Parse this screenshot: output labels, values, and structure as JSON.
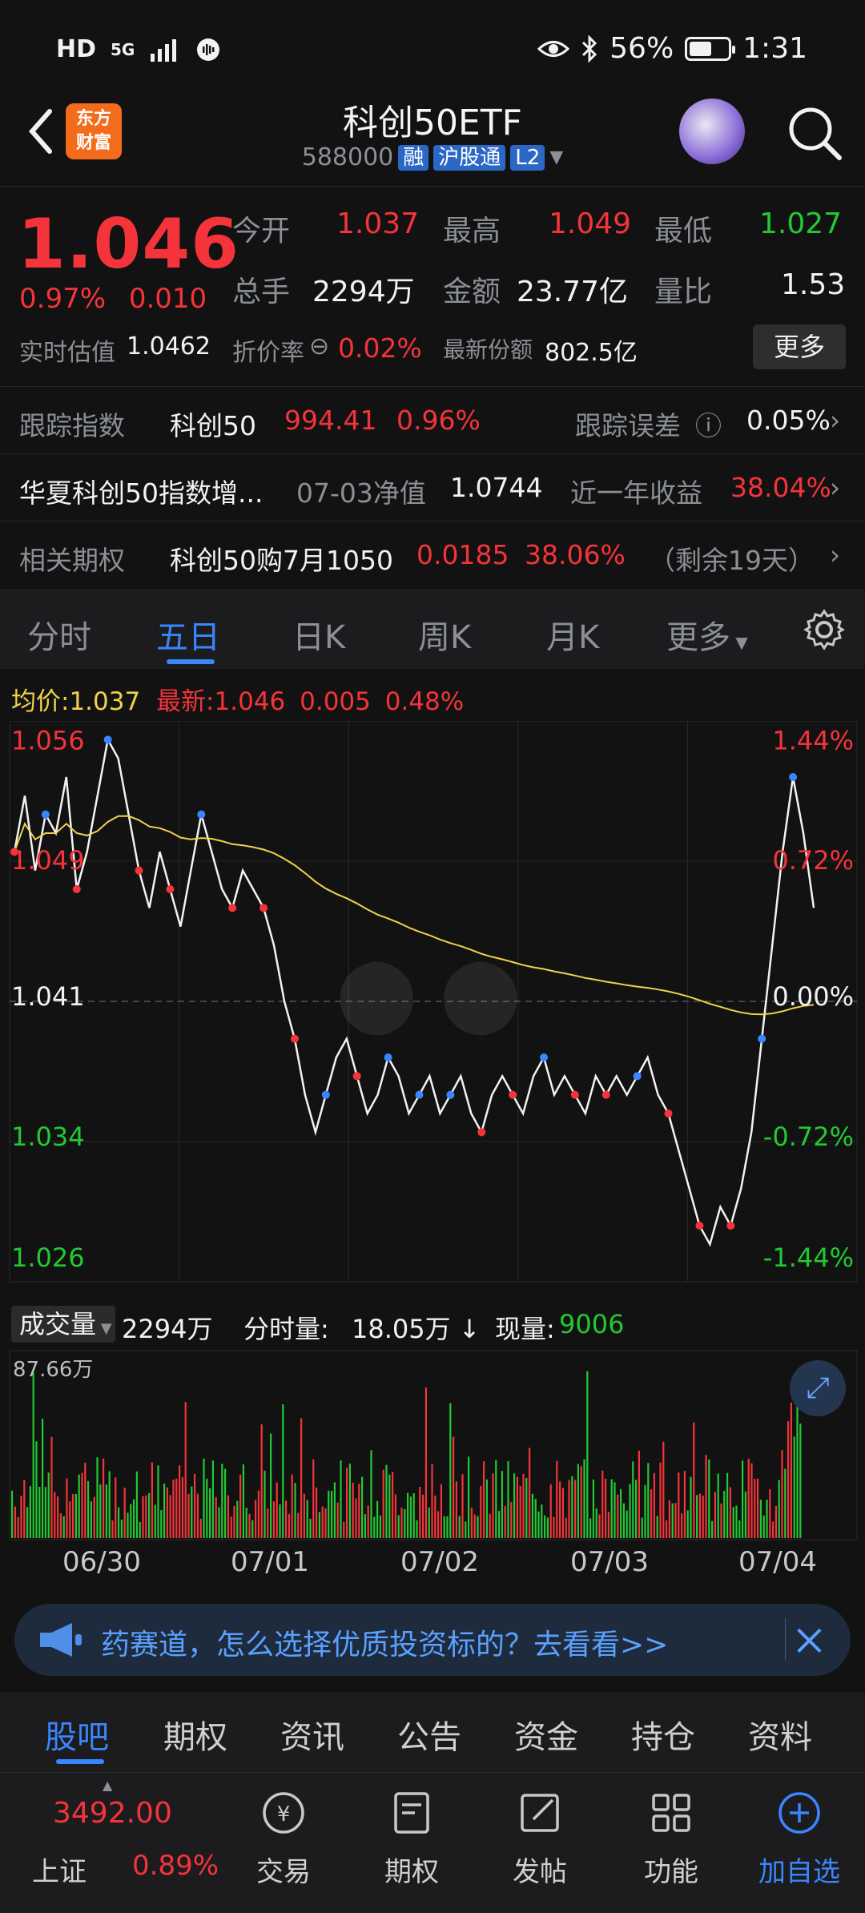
{
  "status_bar": {
    "left": [
      "HD",
      "5G",
      "signal-icon",
      "audio-icon"
    ],
    "battery_percent": "56%",
    "battery_level": 0.56,
    "time": "1:31"
  },
  "header": {
    "logo_text_line1": "东方",
    "logo_text_line2": "财富",
    "title": "科创50ETF",
    "code": "588000",
    "tags": [
      "融",
      "沪股通",
      "L2"
    ]
  },
  "quote": {
    "price": "1.046",
    "change_pct": "0.97%",
    "change_abs": "0.010",
    "open_label": "今开",
    "open": "1.037",
    "high_label": "最高",
    "high": "1.049",
    "low_label": "最低",
    "low": "1.027",
    "volume_label": "总手",
    "volume": "2294万",
    "amount_label": "金额",
    "amount": "23.77亿",
    "ratio_label": "量比",
    "ratio": "1.53",
    "iopv_label": "实时估值",
    "iopv": "1.0462",
    "premium_label": "折价率",
    "premium": "0.02%",
    "shares_label": "最新份额",
    "shares": "802.5亿",
    "more_label": "更多"
  },
  "info_rows": {
    "track_label": "跟踪指数",
    "track_name": "科创50",
    "track_value": "994.41",
    "track_pct": "0.96%",
    "error_label": "跟踪误差",
    "error_value": "0.05%",
    "fund_name": "华夏科创50指数增...",
    "nav_label": "07-03净值",
    "nav_value": "1.0744",
    "yield_label": "近一年收益",
    "yield_value": "38.04%",
    "option_label": "相关期权",
    "option_name": "科创50购7月1050",
    "option_price": "0.0185",
    "option_pct": "38.06%",
    "option_days": "（剩余19天）"
  },
  "chart_tabs": [
    "分时",
    "五日",
    "日K",
    "周K",
    "月K",
    "更多"
  ],
  "chart_header": {
    "avg_label": "均价:",
    "avg_value": "1.037",
    "last_label": "最新:",
    "last_value": "1.046",
    "last_chg": "0.005",
    "last_pct": "0.48%"
  },
  "chart_data": {
    "type": "line",
    "y_labels_left": [
      "1.056",
      "1.049",
      "1.041",
      "1.034",
      "1.026"
    ],
    "y_labels_right": [
      "1.44%",
      "0.72%",
      "0.00%",
      "-0.72%",
      "-1.44%"
    ],
    "ylim": [
      1.026,
      1.056
    ],
    "x_labels": [
      "06/30",
      "07/01",
      "07/02",
      "07/03",
      "07/04"
    ],
    "series": [
      {
        "values": [
          1.049,
          1.052,
          1.048,
          1.051,
          1.05,
          1.053,
          1.047,
          1.049,
          1.052,
          1.055,
          1.054,
          1.051,
          1.048,
          1.046,
          1.049,
          1.047,
          1.045,
          1.048,
          1.051,
          1.049,
          1.047,
          1.046,
          1.048,
          1.047,
          1.046,
          1.044,
          1.041,
          1.039,
          1.036,
          1.034,
          1.036,
          1.038,
          1.039,
          1.037,
          1.035,
          1.036,
          1.038,
          1.037,
          1.035,
          1.036,
          1.037,
          1.035,
          1.036,
          1.037,
          1.035,
          1.034,
          1.036,
          1.037,
          1.036,
          1.035,
          1.037,
          1.038,
          1.036,
          1.037,
          1.036,
          1.035,
          1.037,
          1.036,
          1.037,
          1.036,
          1.037,
          1.038,
          1.036,
          1.035,
          1.033,
          1.031,
          1.029,
          1.028,
          1.03,
          1.029,
          1.031,
          1.034,
          1.039,
          1.044,
          1.049,
          1.053,
          1.05,
          1.046
        ]
      }
    ],
    "volume": {
      "total_label": "成交量",
      "total": "2294万",
      "tick_label": "分时量:",
      "tick_value": "18.05万 ↓",
      "now_label": "现量:",
      "now_value": "9006",
      "max_label": "87.66万"
    }
  },
  "promo": {
    "text": "药赛道，怎么选择优质投资标的？去看看>>"
  },
  "section_tabs": [
    "股吧",
    "期权",
    "资讯",
    "公告",
    "资金",
    "持仓",
    "资料"
  ],
  "bottom_bar": {
    "index_value": "3492.00",
    "index_name": "上证",
    "index_pct": "0.89%",
    "items": [
      "交易",
      "期权",
      "发帖",
      "功能",
      "加自选"
    ]
  },
  "colors": {
    "up": "#f5333a",
    "down": "#22c933",
    "accent": "#3a86ff",
    "avg": "#f0d24a",
    "brand": "#f36c1b"
  }
}
